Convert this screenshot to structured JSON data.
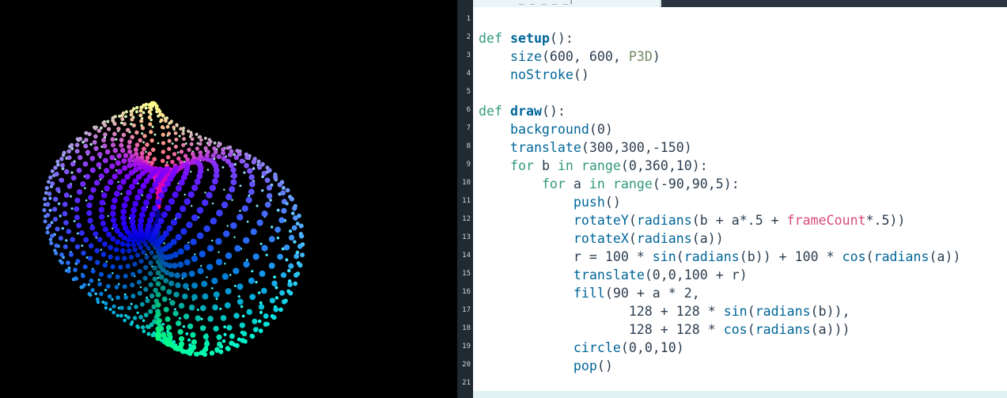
{
  "editor": {
    "line_numbers": [
      "1",
      "2",
      "3",
      "4",
      "5",
      "6",
      "7",
      "8",
      "9",
      "10",
      "11",
      "12",
      "13",
      "14",
      "15",
      "16",
      "17",
      "18",
      "19",
      "20",
      "21"
    ],
    "lines": [
      [],
      [
        {
          "t": "def ",
          "c": "kw"
        },
        {
          "t": "setup",
          "c": "def-name"
        },
        {
          "t": "():",
          "c": ""
        }
      ],
      [
        {
          "t": "    ",
          "c": ""
        },
        {
          "t": "size",
          "c": "fn"
        },
        {
          "t": "(600, 600, ",
          "c": ""
        },
        {
          "t": "P3D",
          "c": "const"
        },
        {
          "t": ")",
          "c": ""
        }
      ],
      [
        {
          "t": "    ",
          "c": ""
        },
        {
          "t": "noStroke",
          "c": "fn"
        },
        {
          "t": "()",
          "c": ""
        }
      ],
      [],
      [
        {
          "t": "def ",
          "c": "kw"
        },
        {
          "t": "draw",
          "c": "def-name"
        },
        {
          "t": "():",
          "c": ""
        }
      ],
      [
        {
          "t": "    ",
          "c": ""
        },
        {
          "t": "background",
          "c": "fn"
        },
        {
          "t": "(0)",
          "c": ""
        }
      ],
      [
        {
          "t": "    ",
          "c": ""
        },
        {
          "t": "translate",
          "c": "fn"
        },
        {
          "t": "(300,300,-150)",
          "c": ""
        }
      ],
      [
        {
          "t": "    ",
          "c": ""
        },
        {
          "t": "for",
          "c": "kw"
        },
        {
          "t": " b ",
          "c": ""
        },
        {
          "t": "in",
          "c": "kw"
        },
        {
          "t": " ",
          "c": ""
        },
        {
          "t": "range",
          "c": "kw"
        },
        {
          "t": "(0,360,10):",
          "c": ""
        }
      ],
      [
        {
          "t": "        ",
          "c": ""
        },
        {
          "t": "for",
          "c": "kw"
        },
        {
          "t": " a ",
          "c": ""
        },
        {
          "t": "in",
          "c": "kw"
        },
        {
          "t": " ",
          "c": ""
        },
        {
          "t": "range",
          "c": "kw"
        },
        {
          "t": "(-90,90,5):",
          "c": ""
        }
      ],
      [
        {
          "t": "            ",
          "c": ""
        },
        {
          "t": "push",
          "c": "fn"
        },
        {
          "t": "()",
          "c": ""
        }
      ],
      [
        {
          "t": "            ",
          "c": ""
        },
        {
          "t": "rotateY",
          "c": "fn"
        },
        {
          "t": "(",
          "c": ""
        },
        {
          "t": "radians",
          "c": "fn"
        },
        {
          "t": "(b + a*.5 + ",
          "c": ""
        },
        {
          "t": "frameCount",
          "c": "var-pink"
        },
        {
          "t": "*.5))",
          "c": ""
        }
      ],
      [
        {
          "t": "            ",
          "c": ""
        },
        {
          "t": "rotateX",
          "c": "fn"
        },
        {
          "t": "(",
          "c": ""
        },
        {
          "t": "radians",
          "c": "fn"
        },
        {
          "t": "(a))",
          "c": ""
        }
      ],
      [
        {
          "t": "            r = 100 * ",
          "c": ""
        },
        {
          "t": "sin",
          "c": "fn"
        },
        {
          "t": "(",
          "c": ""
        },
        {
          "t": "radians",
          "c": "fn"
        },
        {
          "t": "(b)) + 100 * ",
          "c": ""
        },
        {
          "t": "cos",
          "c": "fn"
        },
        {
          "t": "(",
          "c": ""
        },
        {
          "t": "radians",
          "c": "fn"
        },
        {
          "t": "(a))",
          "c": ""
        }
      ],
      [
        {
          "t": "            ",
          "c": ""
        },
        {
          "t": "translate",
          "c": "fn"
        },
        {
          "t": "(0,0,100 + r)",
          "c": ""
        }
      ],
      [
        {
          "t": "            ",
          "c": ""
        },
        {
          "t": "fill",
          "c": "fn"
        },
        {
          "t": "(90 + a * 2,",
          "c": ""
        }
      ],
      [
        {
          "t": "                   128 + 128 * ",
          "c": ""
        },
        {
          "t": "sin",
          "c": "fn"
        },
        {
          "t": "(",
          "c": ""
        },
        {
          "t": "radians",
          "c": "fn"
        },
        {
          "t": "(b)),",
          "c": ""
        }
      ],
      [
        {
          "t": "                   128 + 128 * ",
          "c": ""
        },
        {
          "t": "cos",
          "c": "fn"
        },
        {
          "t": "(",
          "c": ""
        },
        {
          "t": "radians",
          "c": "fn"
        },
        {
          "t": "(a)))",
          "c": ""
        }
      ],
      [
        {
          "t": "            ",
          "c": ""
        },
        {
          "t": "circle",
          "c": "fn"
        },
        {
          "t": "(0,0,10)",
          "c": ""
        }
      ],
      [
        {
          "t": "            ",
          "c": ""
        },
        {
          "t": "pop",
          "c": "fn"
        },
        {
          "t": "()",
          "c": ""
        }
      ],
      []
    ]
  },
  "colors": {
    "keyword": "#33997e",
    "function": "#006699",
    "constant": "#718a62",
    "frameCount": "#d94a7a",
    "text": "#2c3e50",
    "gutter": "#1f2a33",
    "editor_bg": "#ffffff",
    "sketch_bg": "#000000"
  },
  "sketch": {
    "b_step": 10,
    "a_min": -90,
    "a_max": 90,
    "a_step": 5,
    "frameCount": 150
  }
}
